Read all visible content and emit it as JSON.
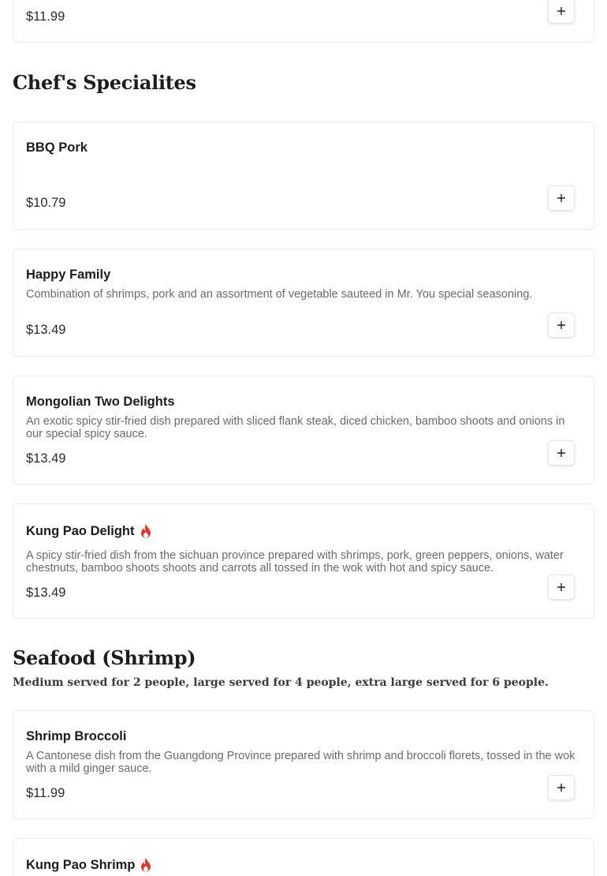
{
  "top_card": {
    "price": "$11.99"
  },
  "sections": [
    {
      "title": "Chef's Specialites",
      "items": [
        {
          "name": "BBQ Pork",
          "description": "",
          "price": "$10.79",
          "spicy": false
        },
        {
          "name": "Happy Family",
          "description": "Combination of shrimps, pork and an assortment of vegetable sauteed in Mr. You special seasoning.",
          "price": "$13.49",
          "spicy": false
        },
        {
          "name": "Mongolian Two Delights",
          "description": "An exotic spicy stir-fried dish prepared with sliced flank steak, diced chicken, bamboo shoots and onions in our special spicy sauce.",
          "price": "$13.49",
          "spicy": false
        },
        {
          "name": "Kung Pao Delight",
          "description": "A spicy stir-fried dish from the sichuan province prepared with shrimps, pork, green peppers, onions, water chestnuts, bamboo shoots shoots and carrots all tossed in the wok with hot and spicy sauce.",
          "price": "$13.49",
          "spicy": true
        }
      ]
    },
    {
      "title": "Seafood (Shrimp)",
      "subtitle": "Medium served for 2 people, large served for 4 people, extra large served for 6 people.",
      "items": [
        {
          "name": "Shrimp Broccoli",
          "description": "A Cantonese dish from the Guangdong Province prepared with shrimp and broccoli florets, tossed in the wok with a mild ginger sauce.",
          "price": "$11.99",
          "spicy": false
        },
        {
          "name": "Kung Pao Shrimp",
          "spicy": true
        }
      ]
    }
  ],
  "icons": {
    "add": "plus-icon",
    "spicy": "flame-icon"
  },
  "colors": {
    "spicy": "#d63b2f",
    "border": "#ececec"
  }
}
